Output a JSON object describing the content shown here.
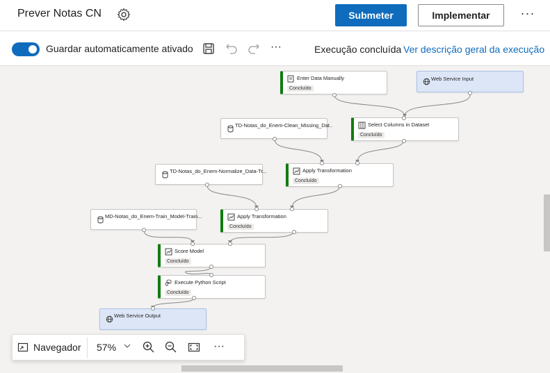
{
  "header": {
    "title": "Prever Notas CN",
    "submit_label": "Submeter",
    "deploy_label": "Implementar",
    "more_label": "···"
  },
  "toolbar": {
    "autosave_label": "Guardar automaticamente ativado",
    "autosave_on": true,
    "more_label": "···",
    "run_status": "Execução concluída",
    "run_link": "Ver descrição geral da execução"
  },
  "nodes": [
    {
      "id": "enter-data",
      "label": "Enter Data Manually",
      "status": "Concluído",
      "type": "module",
      "icon": "data-entry-icon"
    },
    {
      "id": "web-input",
      "label": "Web Service Input",
      "status": "",
      "type": "web",
      "icon": "globe-icon"
    },
    {
      "id": "clean-dataset",
      "label": "TD-Notas_do_Enem-Clean_Missing_Dat...",
      "status": "",
      "type": "dataset",
      "icon": "dataset-icon"
    },
    {
      "id": "select-columns",
      "label": "Select Columns in Dataset",
      "status": "Concluído",
      "type": "module",
      "icon": "columns-icon"
    },
    {
      "id": "normalize-dataset",
      "label": "TD-Notas_do_Enem-Normalize_Data-Tr...",
      "status": "",
      "type": "dataset",
      "icon": "dataset-icon"
    },
    {
      "id": "apply-transform-1",
      "label": "Apply Transformation",
      "status": "Concluído",
      "type": "module",
      "icon": "transform-icon"
    },
    {
      "id": "train-model",
      "label": "MD-Notas_do_Enem-Train_Model-Train...",
      "status": "",
      "type": "dataset",
      "icon": "model-icon"
    },
    {
      "id": "apply-transform-2",
      "label": "Apply Transformation",
      "status": "Concluído",
      "type": "module",
      "icon": "transform-icon"
    },
    {
      "id": "score-model",
      "label": "Score Model",
      "status": "Concluído",
      "type": "module",
      "icon": "score-icon"
    },
    {
      "id": "python-script",
      "label": "Execute Python Script",
      "status": "Concluído",
      "type": "module",
      "icon": "python-icon"
    },
    {
      "id": "web-output",
      "label": "Web Service Output",
      "status": "",
      "type": "web",
      "icon": "globe-icon"
    }
  ],
  "navigator": {
    "label": "Navegador",
    "zoom": "57%",
    "more_label": "···"
  },
  "colors": {
    "accent": "#0f6cbd",
    "success": "#107c10",
    "web_node": "#dce6f7",
    "canvas": "#f3f2f1"
  }
}
